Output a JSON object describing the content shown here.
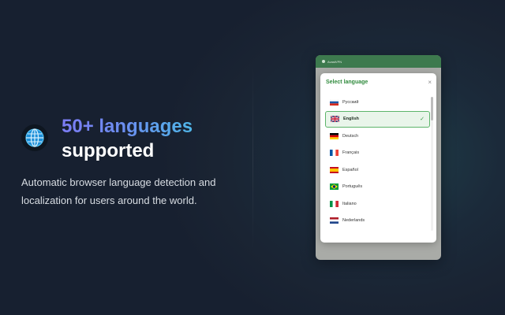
{
  "promo": {
    "headline_accent": "50+ languages",
    "headline_rest": "supported",
    "description": "Automatic browser language detection and localization for users around the world."
  },
  "app": {
    "title": "AvastVPN"
  },
  "modal": {
    "title": "Select language",
    "close_symbol": "×",
    "check_symbol": "✓",
    "languages": [
      {
        "label": "Русский",
        "flag": "ru-flag-icon",
        "selected": false
      },
      {
        "label": "English",
        "flag": "uk-flag-icon",
        "selected": true
      },
      {
        "label": "Deutsch",
        "flag": "de-flag-icon",
        "selected": false
      },
      {
        "label": "Français",
        "flag": "fr-flag-icon",
        "selected": false
      },
      {
        "label": "Español",
        "flag": "es-flag-icon",
        "selected": false
      },
      {
        "label": "Português",
        "flag": "br-flag-icon",
        "selected": false
      },
      {
        "label": "Italiano",
        "flag": "it-flag-icon",
        "selected": false
      },
      {
        "label": "Nederlands",
        "flag": "nl-flag-icon",
        "selected": false
      }
    ]
  },
  "colors": {
    "accent_start": "#7c7cf4",
    "accent_end": "#4fb6e8",
    "modal_title": "#2f8a3c",
    "selected_border": "#5cb46a"
  }
}
